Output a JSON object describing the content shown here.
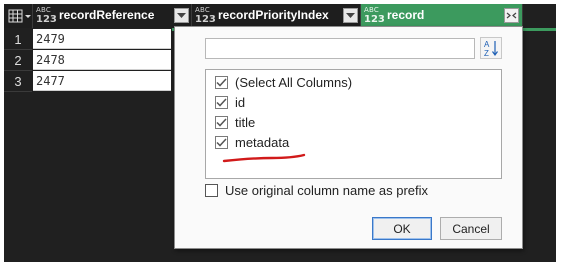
{
  "grid": {
    "columns": [
      {
        "type_top": "ABC",
        "type_bottom": "123",
        "name": "recordReference"
      },
      {
        "type_top": "ABC",
        "type_bottom": "123",
        "name": "recordPriorityIndex"
      },
      {
        "type_top": "ABC",
        "type_bottom": "123",
        "name": "record"
      }
    ],
    "rows": [
      {
        "num": "1",
        "value": "2479"
      },
      {
        "num": "2",
        "value": "2478"
      },
      {
        "num": "3",
        "value": "2477"
      }
    ],
    "selected_column_color": "#3c9a5e"
  },
  "expand_dialog": {
    "search_value": "",
    "sort_icon": "sort-az-icon",
    "columns": [
      {
        "label": "(Select All Columns)",
        "checked": true
      },
      {
        "label": "id",
        "checked": true
      },
      {
        "label": "title",
        "checked": true
      },
      {
        "label": "metadata",
        "checked": true
      }
    ],
    "prefix_option": {
      "label": "Use original column name as prefix",
      "checked": false
    },
    "ok_label": "OK",
    "cancel_label": "Cancel",
    "annotation_color": "#d11a1a"
  }
}
